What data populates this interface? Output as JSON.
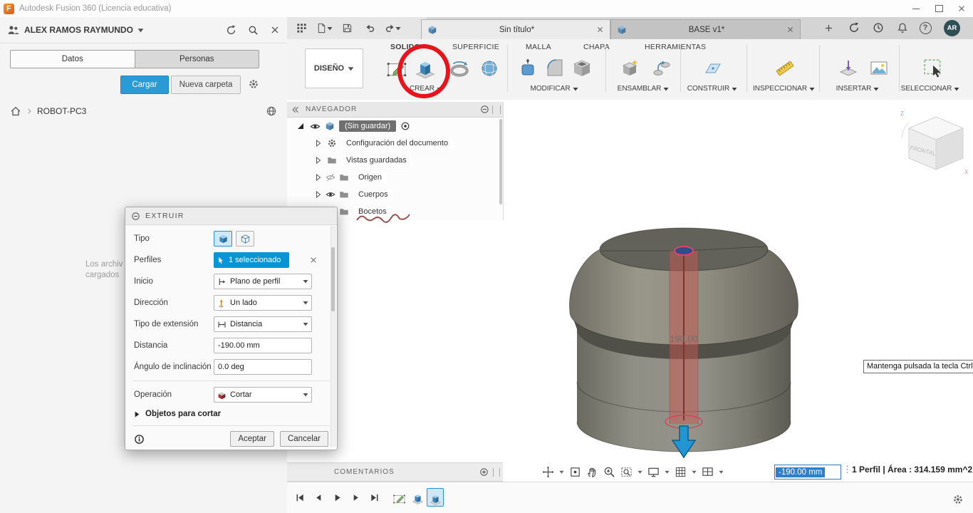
{
  "titlebar": {
    "title": "Autodesk Fusion 360 (Licencia educativa)",
    "logo_letter": "F"
  },
  "icons": {
    "help": "?"
  },
  "data_panel": {
    "user_name": "ALEX RAMOS RAYMUNDO",
    "tabs": {
      "datos": "Datos",
      "personas": "Personas"
    },
    "buttons": {
      "upload": "Cargar",
      "new_folder": "Nueva carpeta"
    },
    "location": "ROBOT-PC3",
    "loading": {
      "line1": "Los archiv",
      "line2": "cargados"
    }
  },
  "document_tabs": {
    "tab1": "Sin título*",
    "tab2": "BASE v1*"
  },
  "account": {
    "avatar_initials": "AR"
  },
  "ribbon": {
    "design_menu": "DISEÑO",
    "tabs": [
      "SOLIDO",
      "SUPERFICIE",
      "MALLA",
      "CHAPA",
      "HERRAMIENTAS"
    ],
    "groups": [
      "CREAR",
      "MODIFICAR",
      "ENSAMBLAR",
      "CONSTRUIR",
      "INSPECCIONAR",
      "INSERTAR",
      "SELECCIONAR"
    ]
  },
  "navigator": {
    "title": "NAVEGADOR",
    "root_label": "(Sin guardar)",
    "items": [
      "Configuración del documento",
      "Vistas guardadas",
      "Origen",
      "Cuerpos",
      "Bocetos"
    ]
  },
  "extrude_dialog": {
    "title": "EXTRUIR",
    "labels": {
      "type": "Tipo",
      "profiles": "Perfiles",
      "start": "Inicio",
      "direction": "Dirección",
      "extent_type": "Tipo de extensión",
      "distance": "Distancia",
      "taper": "Ángulo de inclinación",
      "operation": "Operación"
    },
    "values": {
      "profiles": "1 seleccionado",
      "start": "Plano de perfil",
      "direction": "Un lado",
      "extent_type": "Distancia",
      "distance": "-190.00 mm",
      "taper": "0.0 deg",
      "operation": "Cortar"
    },
    "objects_section": "Objetos para cortar",
    "buttons": {
      "ok": "Aceptar",
      "cancel": "Cancelar"
    }
  },
  "viewport": {
    "dimension_label": "190.00",
    "tooltip": "Mantenga pulsada la tecla Ctrl",
    "viewcube_front": "FRONTAL"
  },
  "comments_panel": {
    "title": "COMENTARIOS"
  },
  "status_bar": {
    "distance_value": "-190.00 mm",
    "selection_info": "1 Perfil | Área : 314.159 mm^2"
  }
}
